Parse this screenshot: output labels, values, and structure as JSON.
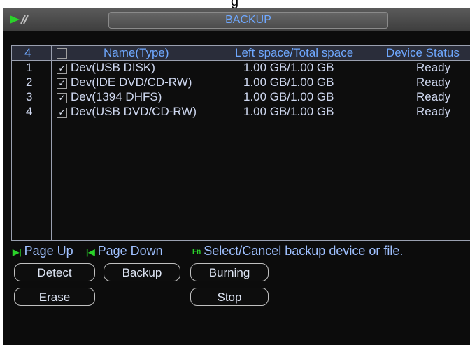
{
  "window": {
    "title": "BACKUP"
  },
  "top_crop_text": "g",
  "table": {
    "count": "4",
    "headers": {
      "name": "Name(Type)",
      "space": "Left space/Total space",
      "status": "Device Status"
    },
    "rows": [
      {
        "idx": "1",
        "name": "Dev(USB DISK)",
        "space": "1.00 GB/1.00 GB",
        "status": "Ready"
      },
      {
        "idx": "2",
        "name": "Dev(IDE DVD/CD-RW)",
        "space": "1.00 GB/1.00 GB",
        "status": "Ready"
      },
      {
        "idx": "3",
        "name": "Dev(1394 DHFS)",
        "space": "1.00 GB/1.00 GB",
        "status": "Ready"
      },
      {
        "idx": "4",
        "name": "Dev(USB DVD/CD-RW)",
        "space": "1.00 GB/1.00 GB",
        "status": "Ready"
      }
    ]
  },
  "hints": {
    "page_up": "Page Up",
    "page_down": "Page Down",
    "fn_label": "Fn",
    "select_cancel": "Select/Cancel backup device or file."
  },
  "buttons": {
    "detect": "Detect",
    "backup": "Backup",
    "burning": "Burning",
    "erase": "Erase",
    "stop": "Stop"
  },
  "colors": {
    "accent": "#6fa8ff",
    "icon_green": "#2ad22a",
    "background": "#0c0c0c"
  }
}
